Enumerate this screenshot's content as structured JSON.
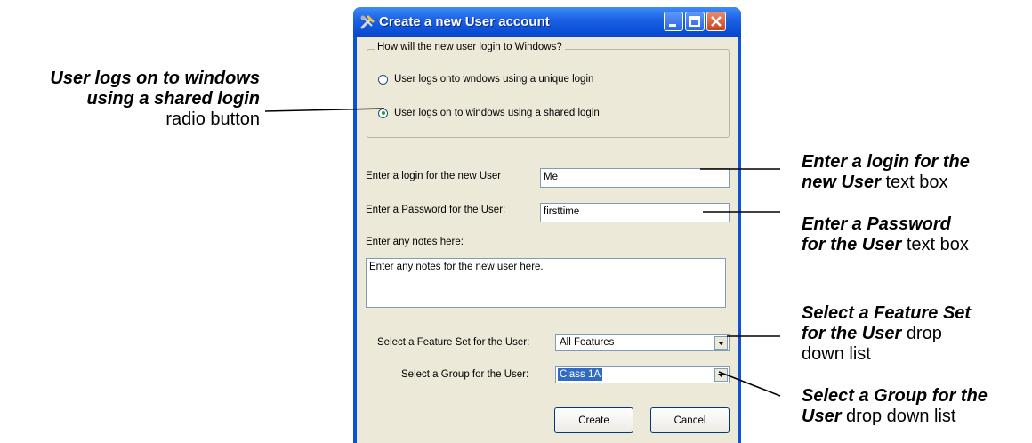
{
  "window": {
    "title": "Create a new User account",
    "login_group": {
      "legend": "How will the new user login to Windows?",
      "option_unique": "User logs onto wndows using a unique login",
      "option_shared": "User logs on to windows using a shared login",
      "selected": "shared"
    },
    "login_label": "Enter a login for the new User",
    "login_value": "Me",
    "password_label": "Enter a Password for the User:",
    "password_value": "firsttime",
    "notes_label": "Enter any notes here:",
    "notes_value": "Enter any notes for the new user here.",
    "feature_set_label": "Select a Feature Set for the User:",
    "feature_set_value": "All Features",
    "group_label": "Select a Group for the User:",
    "group_value": "Class 1A",
    "create_label": "Create",
    "cancel_label": "Cancel"
  },
  "callouts": {
    "shared_login": {
      "bold": "User logs on to windows using a shared login",
      "bold_line1": "User logs on to windows",
      "bold_line2": "using a shared login",
      "plain": "radio button"
    },
    "login_box": {
      "bold_line1": "Enter a login for the",
      "bold_line2": "new User",
      "plain": "text box"
    },
    "password_box": {
      "bold_line1": "Enter a Password",
      "bold_line2": "for the User",
      "plain": "text box"
    },
    "feature_set": {
      "bold_line1": "Select a Feature Set",
      "bold_line2": "for the User",
      "plain_line2": "drop",
      "plain_line3": "down list"
    },
    "group": {
      "bold_line1": "Select a Group for the",
      "bold_line2": "User",
      "plain": "drop down list"
    }
  },
  "colors": {
    "titlebar": "#0a53d8",
    "dialog_bg": "#ece9d8",
    "selection": "#316ac5"
  }
}
